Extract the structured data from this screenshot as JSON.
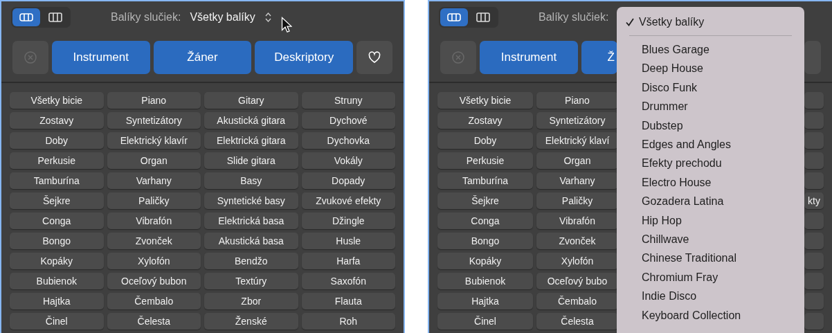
{
  "panels": [
    {
      "view_buttons": [
        {
          "kind": "rows",
          "selected": true
        },
        {
          "kind": "columns",
          "selected": false
        }
      ],
      "header": {
        "label": "Balíky slučiek:",
        "value": "Všetky balíky"
      },
      "buttons": [
        {
          "kind": "clear",
          "disabled": true
        },
        {
          "kind": "category",
          "label": "Instrument"
        },
        {
          "kind": "category",
          "label": "Žáner"
        },
        {
          "kind": "category",
          "label": "Deskriptory"
        },
        {
          "kind": "favorite"
        }
      ],
      "grid": [
        {
          "cells": [
            "Všetky bicie",
            "Piano",
            "Gitary",
            "Struny"
          ]
        },
        {
          "cells": [
            "Zostavy",
            "Syntetizátory",
            "Akustická gitara",
            "Dychové"
          ]
        },
        {
          "cells": [
            "Doby",
            "Elektrický klavír",
            "Elektrická gitara",
            "Dychovka"
          ]
        },
        {
          "cells": [
            "Perkusie",
            "Organ",
            "Slide gitara",
            "Vokály"
          ]
        },
        {
          "cells": [
            "Tamburína",
            "Varhany",
            "Basy",
            "Dopady"
          ]
        },
        {
          "cells": [
            "Šejkre",
            "Paličky",
            "Syntetické basy",
            "Zvukové efekty"
          ]
        },
        {
          "cells": [
            "Conga",
            "Vibrafón",
            "Elektrická basa",
            "Džingle"
          ]
        },
        {
          "cells": [
            "Bongo",
            "Zvonček",
            "Akustická basa",
            "Husle"
          ]
        },
        {
          "cells": [
            "Kopáky",
            "Xylofón",
            "Bendžo",
            "Harfa"
          ]
        },
        {
          "cells": [
            "Bubienok",
            "Oceľový bubon",
            "Textúry",
            "Saxofón"
          ]
        },
        {
          "cells": [
            "Hajtka",
            "Čembalo",
            "Zbor",
            "Flauta"
          ]
        },
        {
          "cells": [
            "Činel",
            "Čelesta",
            "Ženské",
            "Roh"
          ]
        }
      ]
    },
    {
      "view_buttons": [
        {
          "kind": "rows",
          "selected": true
        },
        {
          "kind": "columns",
          "selected": false
        }
      ],
      "header": {
        "label": "Balíky slučiek:"
      },
      "buttons": [
        {
          "kind": "clear",
          "disabled": true
        },
        {
          "kind": "category",
          "label": "Instrument"
        },
        {
          "kind": "category_stub",
          "label": "Ž"
        },
        {
          "kind": "favorite_stub"
        }
      ],
      "grid": [
        {
          "cells": [
            "Všetky bicie",
            "Piano"
          ]
        },
        {
          "cells": [
            "Zostavy",
            "Syntetizátory"
          ]
        },
        {
          "cells": [
            "Doby",
            "Elektrický klaví"
          ]
        },
        {
          "cells": [
            "Perkusie",
            "Organ"
          ]
        },
        {
          "cells": [
            "Tamburína",
            "Varhany"
          ]
        },
        {
          "cells": [
            "Šejkre",
            "Paličky"
          ],
          "edge": "kty"
        },
        {
          "cells": [
            "Conga",
            "Vibrafón"
          ]
        },
        {
          "cells": [
            "Bongo",
            "Zvonček"
          ]
        },
        {
          "cells": [
            "Kopáky",
            "Xylofón"
          ]
        },
        {
          "cells": [
            "Bubienok",
            "Oceľový bubo"
          ]
        },
        {
          "cells": [
            "Hajtka",
            "Čembalo"
          ]
        },
        {
          "cells": [
            "Činel",
            "Čelesta"
          ]
        }
      ],
      "menu": {
        "items": [
          {
            "kind": "option",
            "label": "Všetky balíky",
            "checked": true
          },
          {
            "kind": "separator"
          },
          {
            "kind": "option",
            "label": "Blues Garage",
            "checked": false
          },
          {
            "kind": "option",
            "label": "Deep House",
            "checked": false
          },
          {
            "kind": "option",
            "label": "Disco Funk",
            "checked": false
          },
          {
            "kind": "option",
            "label": "Drummer",
            "checked": false
          },
          {
            "kind": "option",
            "label": "Dubstep",
            "checked": false
          },
          {
            "kind": "option",
            "label": "Edges and Angles",
            "checked": false
          },
          {
            "kind": "option",
            "label": "Efekty prechodu",
            "checked": false
          },
          {
            "kind": "option",
            "label": "Electro House",
            "checked": false
          },
          {
            "kind": "option",
            "label": "Gozadera Latina",
            "checked": false
          },
          {
            "kind": "option",
            "label": "Hip Hop",
            "checked": false
          },
          {
            "kind": "option",
            "label": "Chillwave",
            "checked": false
          },
          {
            "kind": "option",
            "label": "Chinese Traditional",
            "checked": false
          },
          {
            "kind": "option",
            "label": "Chromium Fray",
            "checked": false
          },
          {
            "kind": "option",
            "label": "Indie Disco",
            "checked": false
          },
          {
            "kind": "option",
            "label": "Keyboard Collection",
            "checked": false
          }
        ]
      }
    }
  ]
}
